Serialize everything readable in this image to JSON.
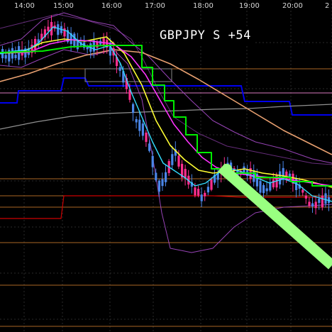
{
  "chart_data": {
    "type": "candlestick",
    "title": "GBPJPY S +54",
    "x_ticks": [
      "14:00",
      "15:00",
      "16:00",
      "17:00",
      "18:00",
      "19:00",
      "20:00",
      "2"
    ],
    "grid": true,
    "colors": {
      "background": "#000000",
      "grid": "#2a2a2a",
      "bull": "#ff2f8f",
      "bear": "#4a86e8",
      "ma_yellow": "#ffff33",
      "ma_magenta": "#ff33ff",
      "ma_cyan": "#33ddff",
      "ma_orange": "#e8a070",
      "ma_green": "#00ee00",
      "envelope": "#a64ac9",
      "gray_ma": "#909090",
      "blue_line": "#0000ee",
      "level_orange": "#c8782a",
      "level_pink": "#ff8ee0",
      "level_red": "#cc0000",
      "trend_band": "#99ff80"
    },
    "trend_band_label": "S"
  }
}
